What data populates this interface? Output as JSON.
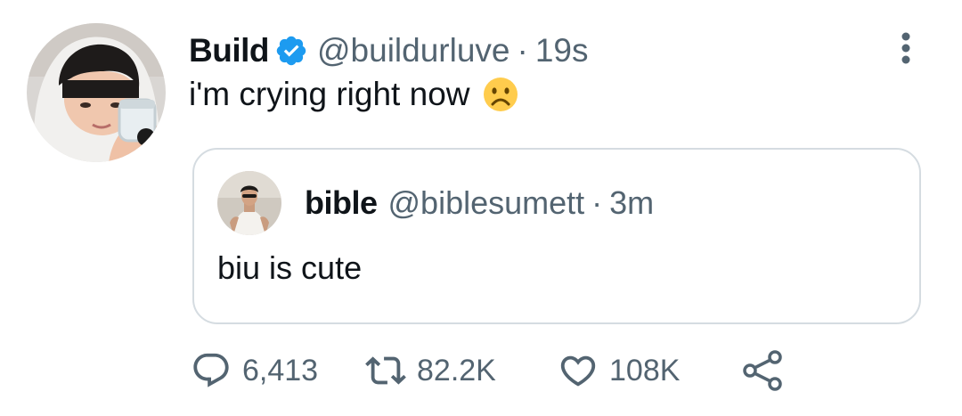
{
  "tweet": {
    "display_name": "Build",
    "handle": "@buildurluve",
    "separator": "·",
    "time": "19s",
    "text": "i'm crying right now",
    "emoji": "frowning-face-emoji",
    "avatar": "user-avatar-photo",
    "verified_icon": "verified-badge-icon",
    "more_icon": "more-options-icon"
  },
  "quoted_tweet": {
    "display_name": "bible",
    "handle": "@biblesumett",
    "separator": "·",
    "time": "3m",
    "text": "biu is cute",
    "avatar": "quoted-user-avatar-photo"
  },
  "actions": {
    "reply": {
      "icon": "reply-icon",
      "count": "6,413"
    },
    "retweet": {
      "icon": "retweet-icon",
      "count": "82.2K"
    },
    "like": {
      "icon": "heart-icon",
      "count": "108K"
    },
    "share": {
      "icon": "share-icon"
    }
  },
  "colors": {
    "text_primary": "#0f1419",
    "text_secondary": "#536471",
    "verified_blue": "#1d9bf0",
    "border": "#d5dce1",
    "emoji_yellow": "#ffcc4d"
  }
}
